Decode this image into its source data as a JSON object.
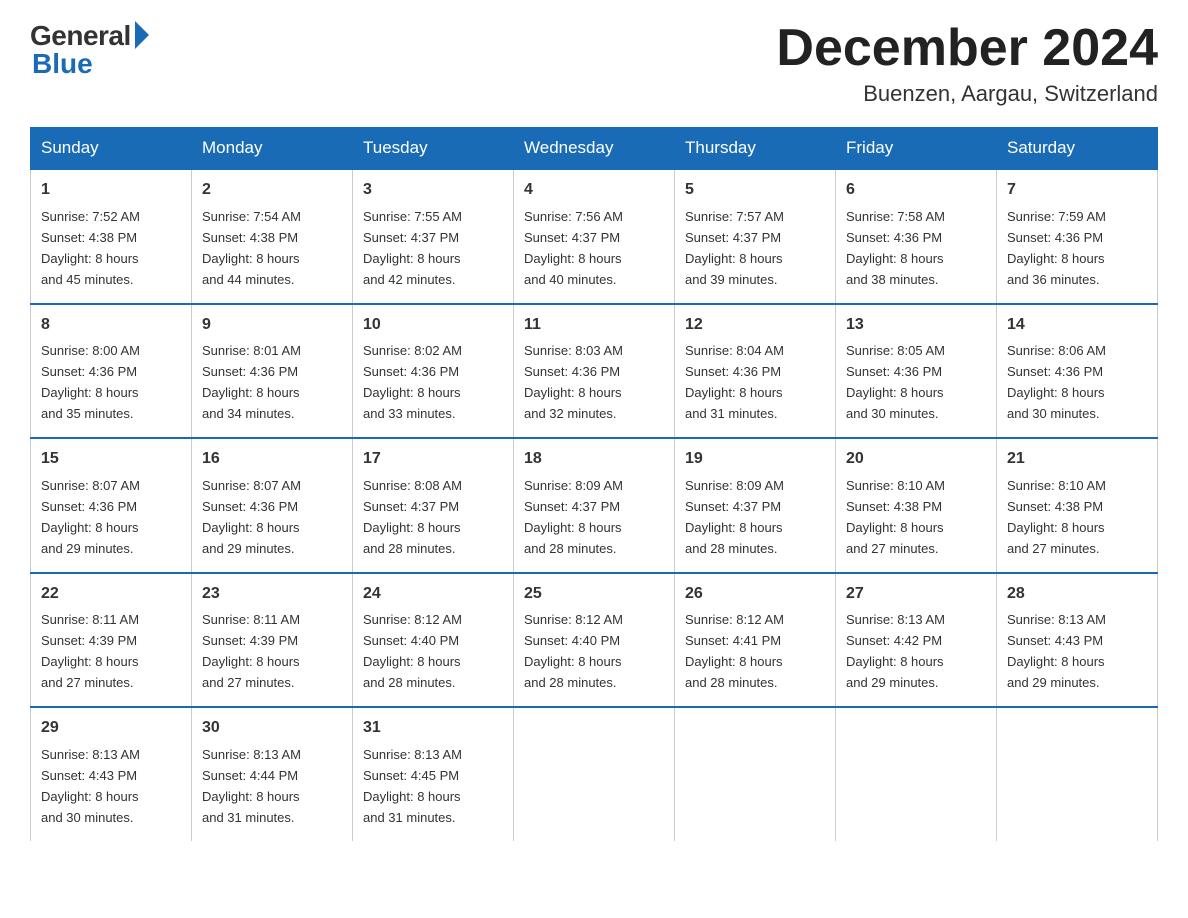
{
  "logo": {
    "general": "General",
    "blue": "Blue"
  },
  "title": "December 2024",
  "location": "Buenzen, Aargau, Switzerland",
  "days_of_week": [
    "Sunday",
    "Monday",
    "Tuesday",
    "Wednesday",
    "Thursday",
    "Friday",
    "Saturday"
  ],
  "weeks": [
    [
      {
        "day": "1",
        "info": "Sunrise: 7:52 AM\nSunset: 4:38 PM\nDaylight: 8 hours\nand 45 minutes."
      },
      {
        "day": "2",
        "info": "Sunrise: 7:54 AM\nSunset: 4:38 PM\nDaylight: 8 hours\nand 44 minutes."
      },
      {
        "day": "3",
        "info": "Sunrise: 7:55 AM\nSunset: 4:37 PM\nDaylight: 8 hours\nand 42 minutes."
      },
      {
        "day": "4",
        "info": "Sunrise: 7:56 AM\nSunset: 4:37 PM\nDaylight: 8 hours\nand 40 minutes."
      },
      {
        "day": "5",
        "info": "Sunrise: 7:57 AM\nSunset: 4:37 PM\nDaylight: 8 hours\nand 39 minutes."
      },
      {
        "day": "6",
        "info": "Sunrise: 7:58 AM\nSunset: 4:36 PM\nDaylight: 8 hours\nand 38 minutes."
      },
      {
        "day": "7",
        "info": "Sunrise: 7:59 AM\nSunset: 4:36 PM\nDaylight: 8 hours\nand 36 minutes."
      }
    ],
    [
      {
        "day": "8",
        "info": "Sunrise: 8:00 AM\nSunset: 4:36 PM\nDaylight: 8 hours\nand 35 minutes."
      },
      {
        "day": "9",
        "info": "Sunrise: 8:01 AM\nSunset: 4:36 PM\nDaylight: 8 hours\nand 34 minutes."
      },
      {
        "day": "10",
        "info": "Sunrise: 8:02 AM\nSunset: 4:36 PM\nDaylight: 8 hours\nand 33 minutes."
      },
      {
        "day": "11",
        "info": "Sunrise: 8:03 AM\nSunset: 4:36 PM\nDaylight: 8 hours\nand 32 minutes."
      },
      {
        "day": "12",
        "info": "Sunrise: 8:04 AM\nSunset: 4:36 PM\nDaylight: 8 hours\nand 31 minutes."
      },
      {
        "day": "13",
        "info": "Sunrise: 8:05 AM\nSunset: 4:36 PM\nDaylight: 8 hours\nand 30 minutes."
      },
      {
        "day": "14",
        "info": "Sunrise: 8:06 AM\nSunset: 4:36 PM\nDaylight: 8 hours\nand 30 minutes."
      }
    ],
    [
      {
        "day": "15",
        "info": "Sunrise: 8:07 AM\nSunset: 4:36 PM\nDaylight: 8 hours\nand 29 minutes."
      },
      {
        "day": "16",
        "info": "Sunrise: 8:07 AM\nSunset: 4:36 PM\nDaylight: 8 hours\nand 29 minutes."
      },
      {
        "day": "17",
        "info": "Sunrise: 8:08 AM\nSunset: 4:37 PM\nDaylight: 8 hours\nand 28 minutes."
      },
      {
        "day": "18",
        "info": "Sunrise: 8:09 AM\nSunset: 4:37 PM\nDaylight: 8 hours\nand 28 minutes."
      },
      {
        "day": "19",
        "info": "Sunrise: 8:09 AM\nSunset: 4:37 PM\nDaylight: 8 hours\nand 28 minutes."
      },
      {
        "day": "20",
        "info": "Sunrise: 8:10 AM\nSunset: 4:38 PM\nDaylight: 8 hours\nand 27 minutes."
      },
      {
        "day": "21",
        "info": "Sunrise: 8:10 AM\nSunset: 4:38 PM\nDaylight: 8 hours\nand 27 minutes."
      }
    ],
    [
      {
        "day": "22",
        "info": "Sunrise: 8:11 AM\nSunset: 4:39 PM\nDaylight: 8 hours\nand 27 minutes."
      },
      {
        "day": "23",
        "info": "Sunrise: 8:11 AM\nSunset: 4:39 PM\nDaylight: 8 hours\nand 27 minutes."
      },
      {
        "day": "24",
        "info": "Sunrise: 8:12 AM\nSunset: 4:40 PM\nDaylight: 8 hours\nand 28 minutes."
      },
      {
        "day": "25",
        "info": "Sunrise: 8:12 AM\nSunset: 4:40 PM\nDaylight: 8 hours\nand 28 minutes."
      },
      {
        "day": "26",
        "info": "Sunrise: 8:12 AM\nSunset: 4:41 PM\nDaylight: 8 hours\nand 28 minutes."
      },
      {
        "day": "27",
        "info": "Sunrise: 8:13 AM\nSunset: 4:42 PM\nDaylight: 8 hours\nand 29 minutes."
      },
      {
        "day": "28",
        "info": "Sunrise: 8:13 AM\nSunset: 4:43 PM\nDaylight: 8 hours\nand 29 minutes."
      }
    ],
    [
      {
        "day": "29",
        "info": "Sunrise: 8:13 AM\nSunset: 4:43 PM\nDaylight: 8 hours\nand 30 minutes."
      },
      {
        "day": "30",
        "info": "Sunrise: 8:13 AM\nSunset: 4:44 PM\nDaylight: 8 hours\nand 31 minutes."
      },
      {
        "day": "31",
        "info": "Sunrise: 8:13 AM\nSunset: 4:45 PM\nDaylight: 8 hours\nand 31 minutes."
      },
      {
        "day": "",
        "info": ""
      },
      {
        "day": "",
        "info": ""
      },
      {
        "day": "",
        "info": ""
      },
      {
        "day": "",
        "info": ""
      }
    ]
  ]
}
